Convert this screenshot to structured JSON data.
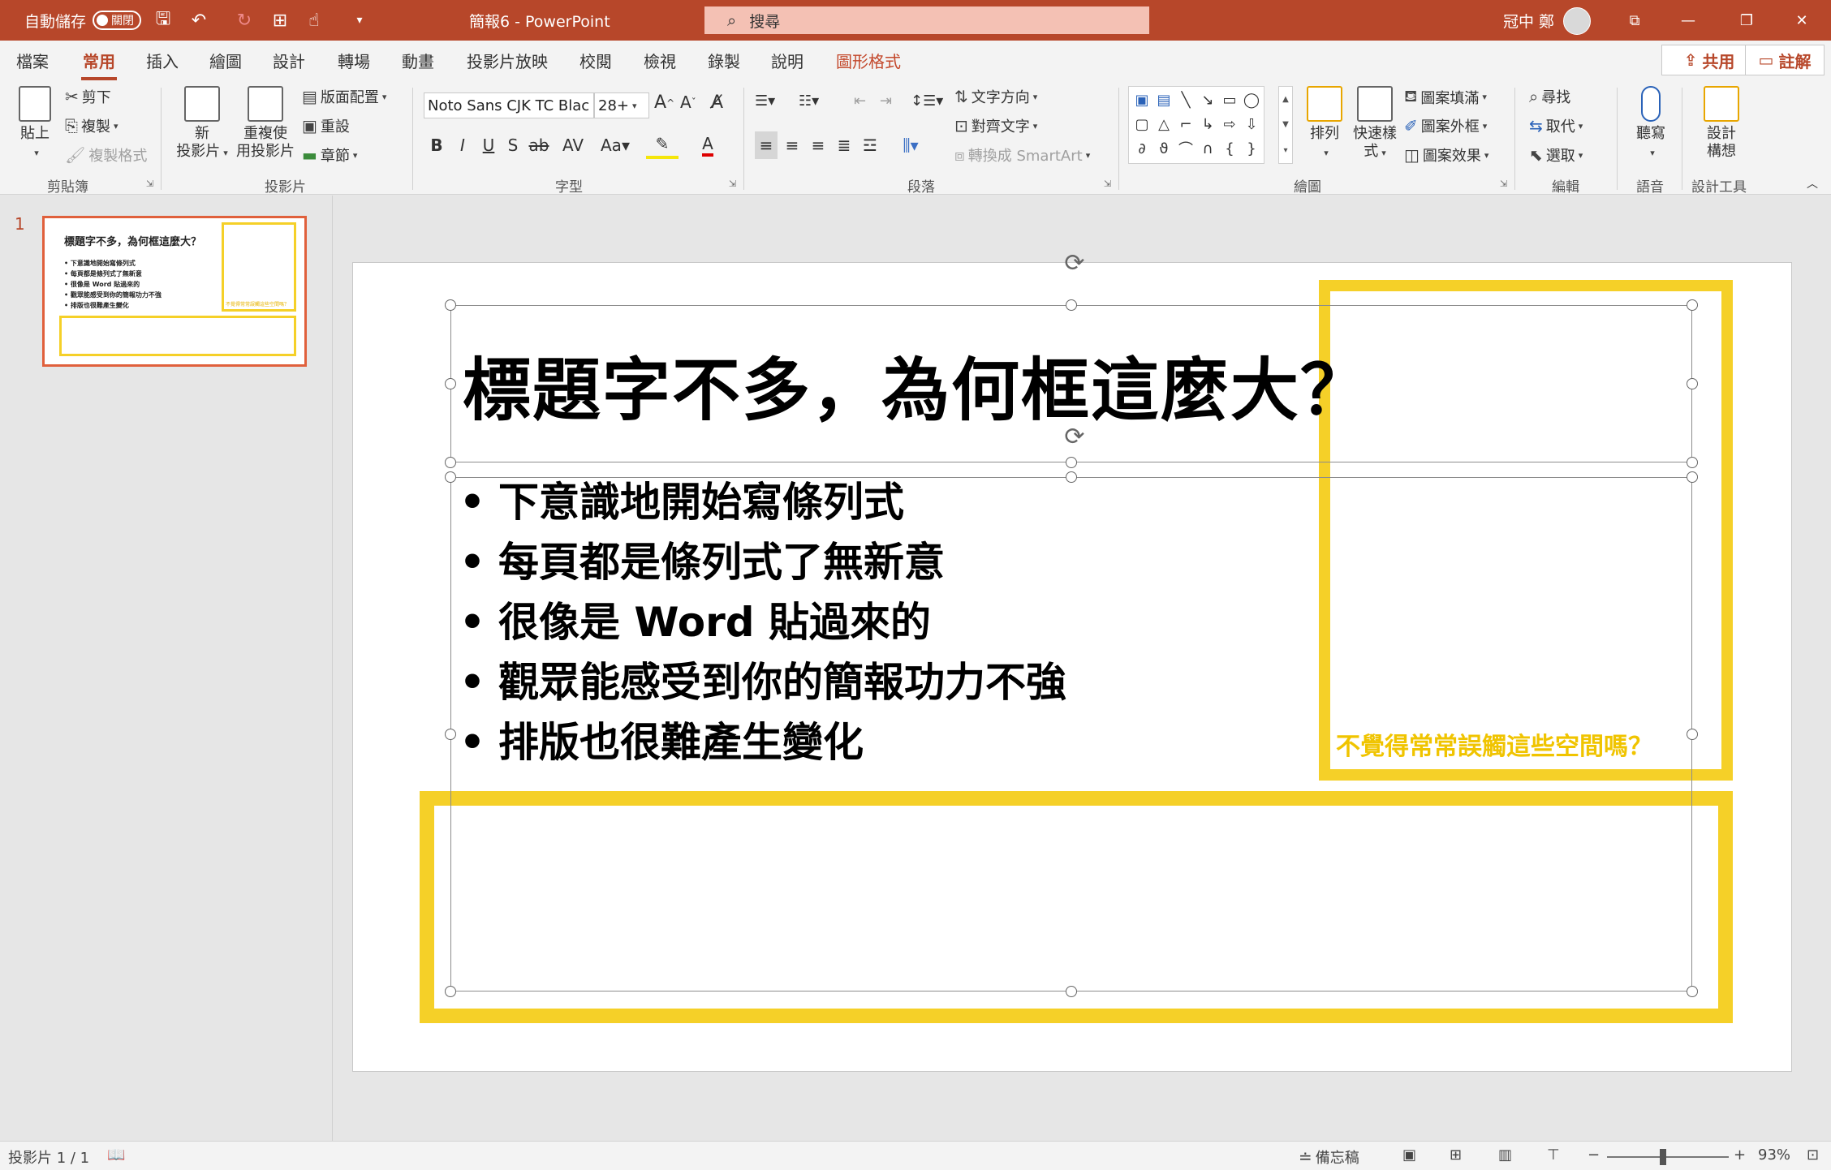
{
  "titlebar": {
    "autosave_label": "自動儲存",
    "autosave_state": "關閉",
    "doc_title": "簡報6  -  PowerPoint",
    "search_placeholder": "搜尋",
    "user_name": "冠中 鄭"
  },
  "tabs": [
    "檔案",
    "常用",
    "插入",
    "繪圖",
    "設計",
    "轉場",
    "動畫",
    "投影片放映",
    "校閱",
    "檢視",
    "錄製",
    "說明",
    "圖形格式"
  ],
  "active_tab": "常用",
  "share_label": "共用",
  "comment_label": "註解",
  "ribbon": {
    "clipboard": {
      "paste": "貼上",
      "cut": "剪下",
      "copy": "複製",
      "format_painter": "複製格式",
      "label": "剪貼簿"
    },
    "slides": {
      "new_slide_1": "新",
      "new_slide_2": "投影片",
      "reuse_1": "重複使",
      "reuse_2": "用投影片",
      "layout": "版面配置",
      "reset": "重設",
      "section": "章節",
      "label": "投影片"
    },
    "font": {
      "name": "Noto Sans CJK TC Blac",
      "size": "28+",
      "label": "字型"
    },
    "paragraph": {
      "text_direction": "文字方向",
      "align_text": "對齊文字",
      "smartart": "轉換成 SmartArt",
      "label": "段落"
    },
    "drawing": {
      "arrange": "排列",
      "quick_styles_1": "快速樣",
      "quick_styles_2": "式",
      "fill": "圖案填滿",
      "outline": "圖案外框",
      "effects": "圖案效果",
      "label": "繪圖"
    },
    "editing": {
      "find": "尋找",
      "replace": "取代",
      "select": "選取",
      "label": "編輯"
    },
    "voice": {
      "dictate": "聽寫",
      "label": "語音"
    },
    "designer": {
      "ideas_1": "設計",
      "ideas_2": "構想",
      "label": "設計工具"
    }
  },
  "thumbnail": {
    "number": "1",
    "title": "標題字不多，為何框這麼大？",
    "bullets": [
      "下意識地開始寫條列式",
      "每頁都是條列式了無新意",
      "很像是 Word 貼過來的",
      "觀眾能感受到你的簡報功力不強",
      "排版也很難產生變化"
    ],
    "note": "不覺得常常誤觸這些空間嗎？"
  },
  "slide": {
    "title": "標題字不多，為何框這麼大？",
    "bullets": [
      "下意識地開始寫條列式",
      "每頁都是條列式了無新意",
      "很像是 Word 貼過來的",
      "觀眾能感受到你的簡報功力不強",
      "排版也很難產生變化"
    ],
    "note": "不覺得常常誤觸這些空間嗎？",
    "highlight_color": "#f5d028"
  },
  "statusbar": {
    "slide_count": "投影片 1 / 1",
    "notes": "備忘稿",
    "zoom": "93%",
    "zoom_fraction": 0.46
  },
  "colors": {
    "accent": "#b7472a",
    "highlight": "#f5d028"
  }
}
